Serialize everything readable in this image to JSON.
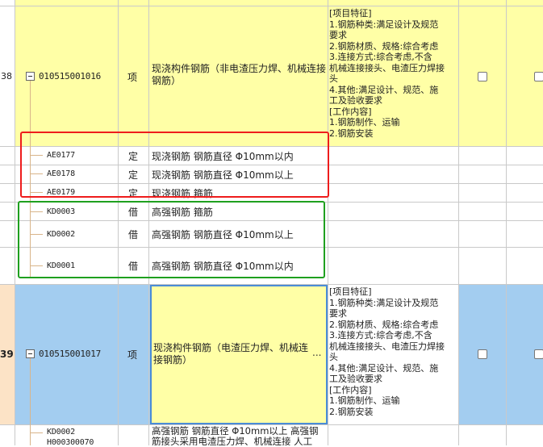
{
  "rows": {
    "r38": {
      "number": "38",
      "code": "010515001016",
      "unit": "项",
      "name": "现浇构件钢筋（非电渣压力焊、机械连接钢筋）",
      "features": "[项目特征]\n1.钢筋种类:满足设计及规范\n要求\n2.钢筋材质、规格:综合考虑\n3.连接方式:综合考虑,不含\n机械连接接头、电渣压力焊接\n头\n4.其他:满足设计、规范、施\n工及验收要求\n[工作内容]\n1.钢筋制作、运输\n2.钢筋安装"
    },
    "sub_ding": [
      {
        "code": "AE0177",
        "type": "定",
        "name": "现浇钢筋 钢筋直径 Φ10mm以内"
      },
      {
        "code": "AE0178",
        "type": "定",
        "name": "现浇钢筋 钢筋直径 Φ10mm以上"
      },
      {
        "code": "AE0179",
        "type": "定",
        "name": "现浇钢筋 箍筋"
      }
    ],
    "sub_jie": [
      {
        "code": "KD0003",
        "type": "借",
        "name": "高强钢筋 箍筋"
      },
      {
        "code": "KD0002",
        "type": "借",
        "name": "高强钢筋 钢筋直径 Φ10mm以上"
      },
      {
        "code": "KD0001",
        "type": "借",
        "name": "高强钢筋 钢筋直径 Φ10mm以内"
      }
    ],
    "r39": {
      "number": "39",
      "code": "010515001017",
      "unit": "项",
      "name": "现浇构件钢筋（电渣压力焊、机械连接钢筋）",
      "ellipsis": "...",
      "features": "[项目特征]\n1.钢筋种类:满足设计及规范\n要求\n2.钢筋材质、规格:综合考虑\n3.连接方式:综合考虑,不含\n机械连接接头、电渣压力焊接\n头\n4.其他:满足设计、规范、施\n工及验收要求\n[工作内容]\n1.钢筋制作、运输\n2.钢筋安装"
    },
    "bottom": {
      "code_line1": "KD0002",
      "code_line2": "H000300070",
      "name": "高强钢筋 钢筋直径 Φ10mm以上  高强钢筋接头采用电渣压力焊、机械连接 人工"
    }
  },
  "colors": {
    "yellow_row": "#ffffa6",
    "blue_row": "#a3cdf0",
    "row_number_bg": "#fce3c6",
    "highlight_red": "#ee1c1c",
    "highlight_green": "#1fa01f",
    "selected_cell_border": "#4a8cd6"
  }
}
